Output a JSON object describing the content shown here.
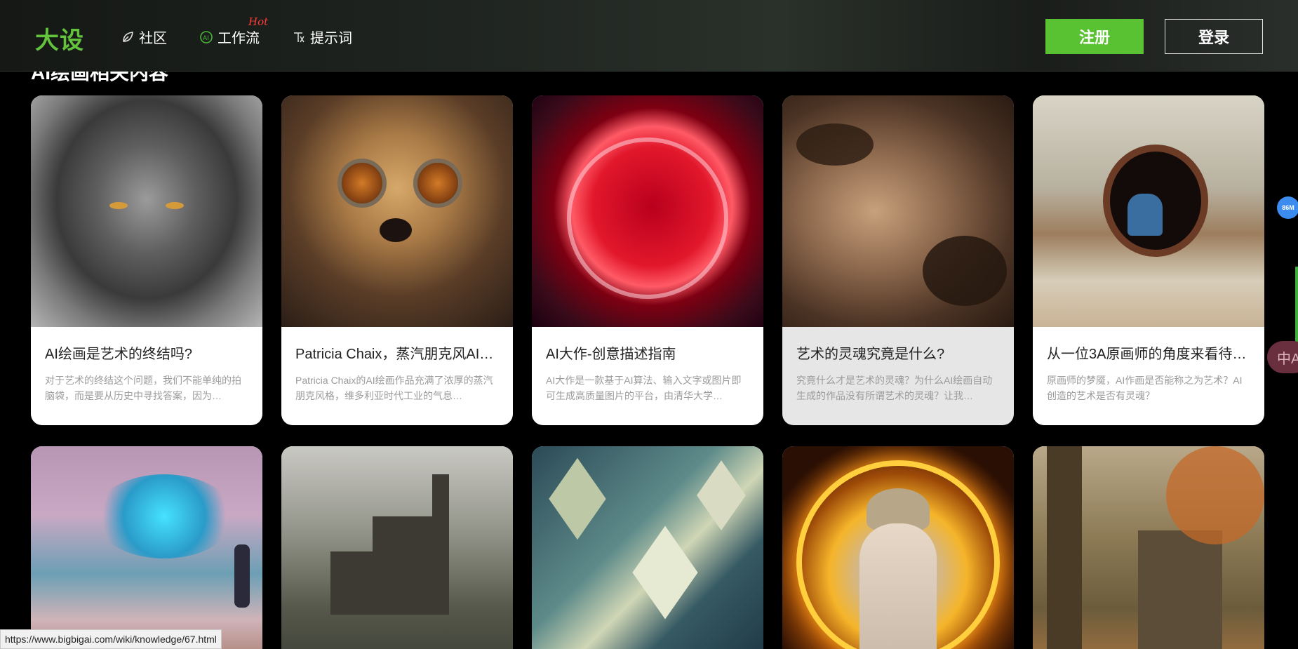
{
  "header": {
    "logo": "大设",
    "nav": [
      {
        "label": "社区",
        "icon": "leaf-icon"
      },
      {
        "label": "工作流",
        "icon": "workflow-icon",
        "badge": "Hot"
      },
      {
        "label": "提示词",
        "icon": "prompt-icon"
      }
    ],
    "register_label": "注册",
    "login_label": "登录"
  },
  "section": {
    "title": "AI绘画相关内容"
  },
  "cards": [
    {
      "title": "AI绘画是艺术的终结吗?",
      "desc": "对于艺术的终结这个问题，我们不能单纯的拍脑袋，而是要从历史中寻找答案，因为…"
    },
    {
      "title": "Patricia Chaix，蒸汽朋克风AI…",
      "desc": "Patricia Chaix的AI绘画作品充满了浓厚的蒸汽朋克风格，维多利亚时代工业的气息…"
    },
    {
      "title": "AI大作-创意描述指南",
      "desc": "AI大作是一款基于AI算法、输入文字或图片即可生成高质量图片的平台，由清华大学…"
    },
    {
      "title": "艺术的灵魂究竟是什么?",
      "desc": "究竟什么才是艺术的灵魂？为什么AI绘画自动生成的作品没有所谓艺术的灵魂？让我…"
    },
    {
      "title": "从一位3A原画师的角度来看待…",
      "desc": "原画师的梦魇，AI作画是否能称之为艺术？AI创造的艺术是否有灵魂？"
    },
    {
      "title": "",
      "desc": ""
    },
    {
      "title": "",
      "desc": ""
    },
    {
      "title": "",
      "desc": ""
    },
    {
      "title": "",
      "desc": ""
    },
    {
      "title": "",
      "desc": ""
    }
  ],
  "status_url": "https://www.bigbigai.com/wiki/knowledge/67.html",
  "float_badge": "86M",
  "translate_label": "中A"
}
